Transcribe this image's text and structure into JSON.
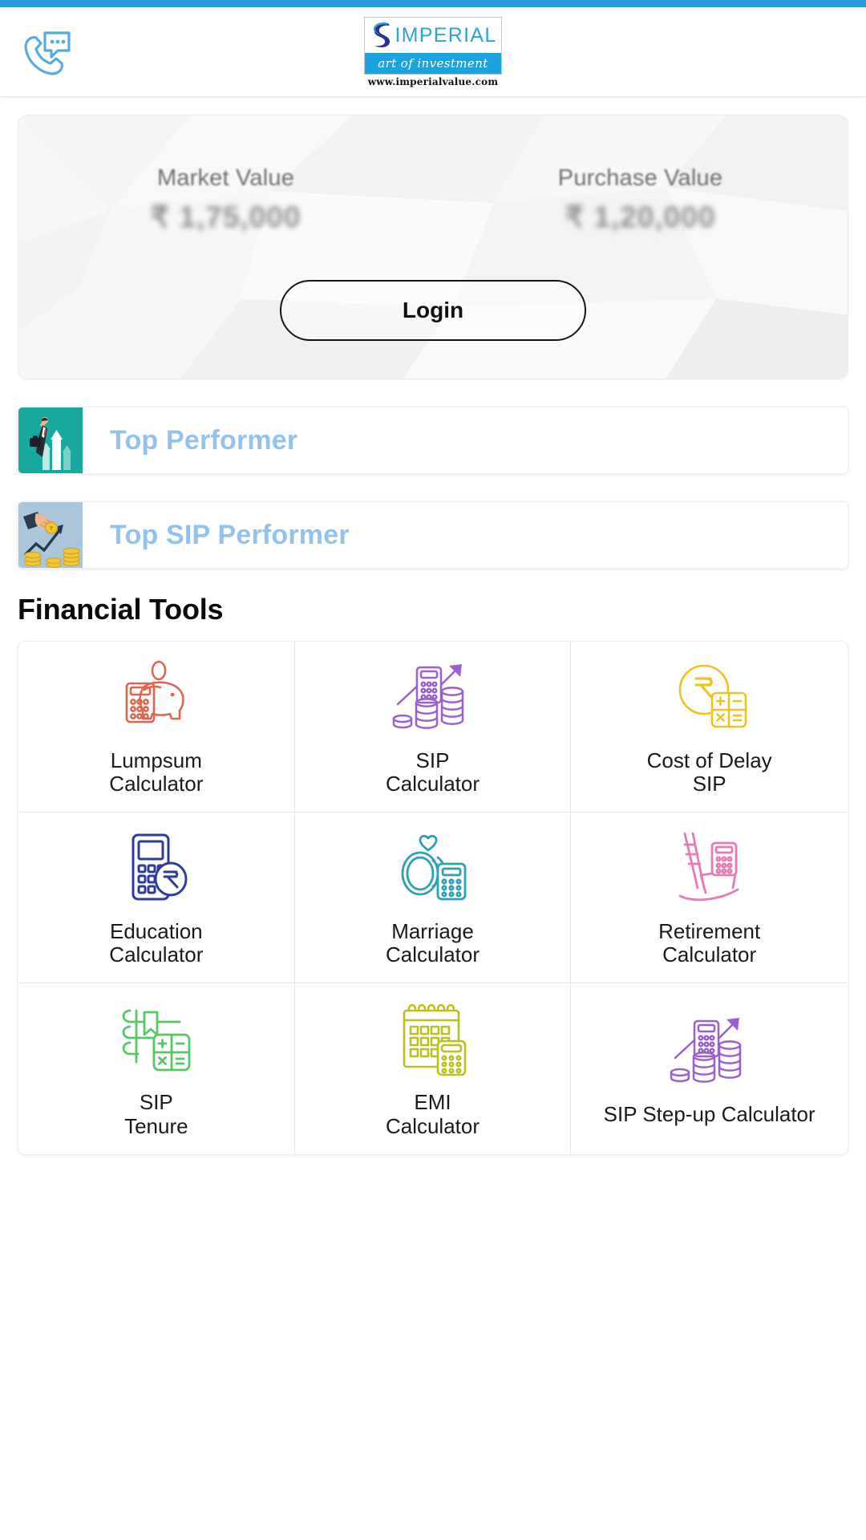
{
  "header": {
    "call_icon": "phone-chat-icon",
    "logo": {
      "word": "IMPERIAL",
      "tagline": "art of investment",
      "url": "www.imperialvalue.com",
      "mark_color": "#2f3192",
      "band_color": "#1ba3e0"
    }
  },
  "portfolio": {
    "market": {
      "label": "Market Value",
      "amount": "₹ 1,75,000"
    },
    "purchase": {
      "label": "Purchase Value",
      "amount": "₹ 1,20,000"
    },
    "login_label": "Login"
  },
  "performers": [
    {
      "label": "Top Performer",
      "icon": "businessman-growth-arrows-icon",
      "icon_bg": "#17a8a0",
      "text_color": "#93c2ec"
    },
    {
      "label": "Top SIP Performer",
      "icon": "hand-coins-growth-icon",
      "icon_bg": "#a9c6dd",
      "text_color": "#93c2ec"
    }
  ],
  "tools": {
    "title": "Financial Tools",
    "items": [
      {
        "label": "Lumpsum\nCalculator",
        "icon": "piggy-bank-calculator-icon",
        "color": "#e0644f"
      },
      {
        "label": "SIP\nCalculator",
        "icon": "coins-calculator-arrow-icon",
        "color": "#9b5fd0"
      },
      {
        "label": "Cost of Delay\nSIP",
        "icon": "rupee-coin-calculator-icon",
        "color": "#efc21f"
      },
      {
        "label": "Education\nCalculator",
        "icon": "calculator-rupee-coin-icon",
        "color": "#2f3a9e"
      },
      {
        "label": "Marriage\nCalculator",
        "icon": "wedding-rings-calculator-icon",
        "color": "#2e9fb5"
      },
      {
        "label": "Retirement\nCalculator",
        "icon": "rocking-chair-calculator-icon",
        "color": "#e878b6"
      },
      {
        "label": "SIP\nTenure",
        "icon": "notebook-math-icon",
        "color": "#56c764"
      },
      {
        "label": "EMI\nCalculator",
        "icon": "calendar-calculator-icon",
        "color": "#bcc01c"
      },
      {
        "label": "SIP Step-up Calculator",
        "icon": "coins-calculator-arrow-icon",
        "color": "#9b5fd0"
      }
    ]
  }
}
